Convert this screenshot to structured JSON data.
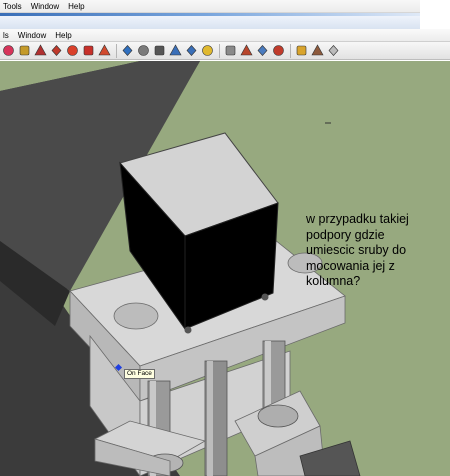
{
  "menus_top": [
    "Tools",
    "Window",
    "Help"
  ],
  "menus_second": [
    "ls",
    "Window",
    "Help"
  ],
  "toolbar": {
    "tools": [
      {
        "name": "eraser-icon",
        "color": "#d7345a"
      },
      {
        "name": "tape-measure-icon",
        "color": "#c49a2a"
      },
      {
        "name": "paint-bucket-icon",
        "color": "#b03030"
      },
      {
        "name": "push-pull-icon",
        "color": "#c0392b"
      },
      {
        "name": "follow-me-icon",
        "color": "#d9402a"
      },
      {
        "name": "rotate-icon",
        "color": "#c7302a"
      },
      {
        "name": "offset-icon",
        "color": "#d14b2f"
      },
      {
        "name": "orbit-icon",
        "color": "#3070c0"
      },
      {
        "name": "pan-icon",
        "color": "#7a7a7a"
      },
      {
        "name": "zoom-icon",
        "color": "#555555"
      },
      {
        "name": "zoom-window-icon",
        "color": "#3a6fb8"
      },
      {
        "name": "zoom-extents-icon",
        "color": "#3a6fb8"
      },
      {
        "name": "section-plane-icon",
        "color": "#e0b92f"
      },
      {
        "name": "dimension-icon",
        "color": "#8a8a8a"
      },
      {
        "name": "3d-warehouse-icon",
        "color": "#b8462c"
      },
      {
        "name": "component-icon",
        "color": "#4a7bbf"
      },
      {
        "name": "google-earth-icon",
        "color": "#c03b2b"
      },
      {
        "name": "components-browser-icon",
        "color": "#d9a42c"
      },
      {
        "name": "materials-icon",
        "color": "#8d5a3c"
      },
      {
        "name": "styles-icon",
        "color": "#bbbbbb"
      }
    ]
  },
  "annotation_lines": [
    "w przypadku takiej",
    "podpory gdzie",
    "umiescic sruby do",
    "mocowania jej z",
    "kolumna?"
  ],
  "tooltip": "On Face",
  "colors": {
    "ground": "#97a97f",
    "dark_slab": "#3a3a3a",
    "light_gray": "#d6d6d6",
    "mid_gray": "#a8a8a8",
    "black_block": "#000000"
  }
}
